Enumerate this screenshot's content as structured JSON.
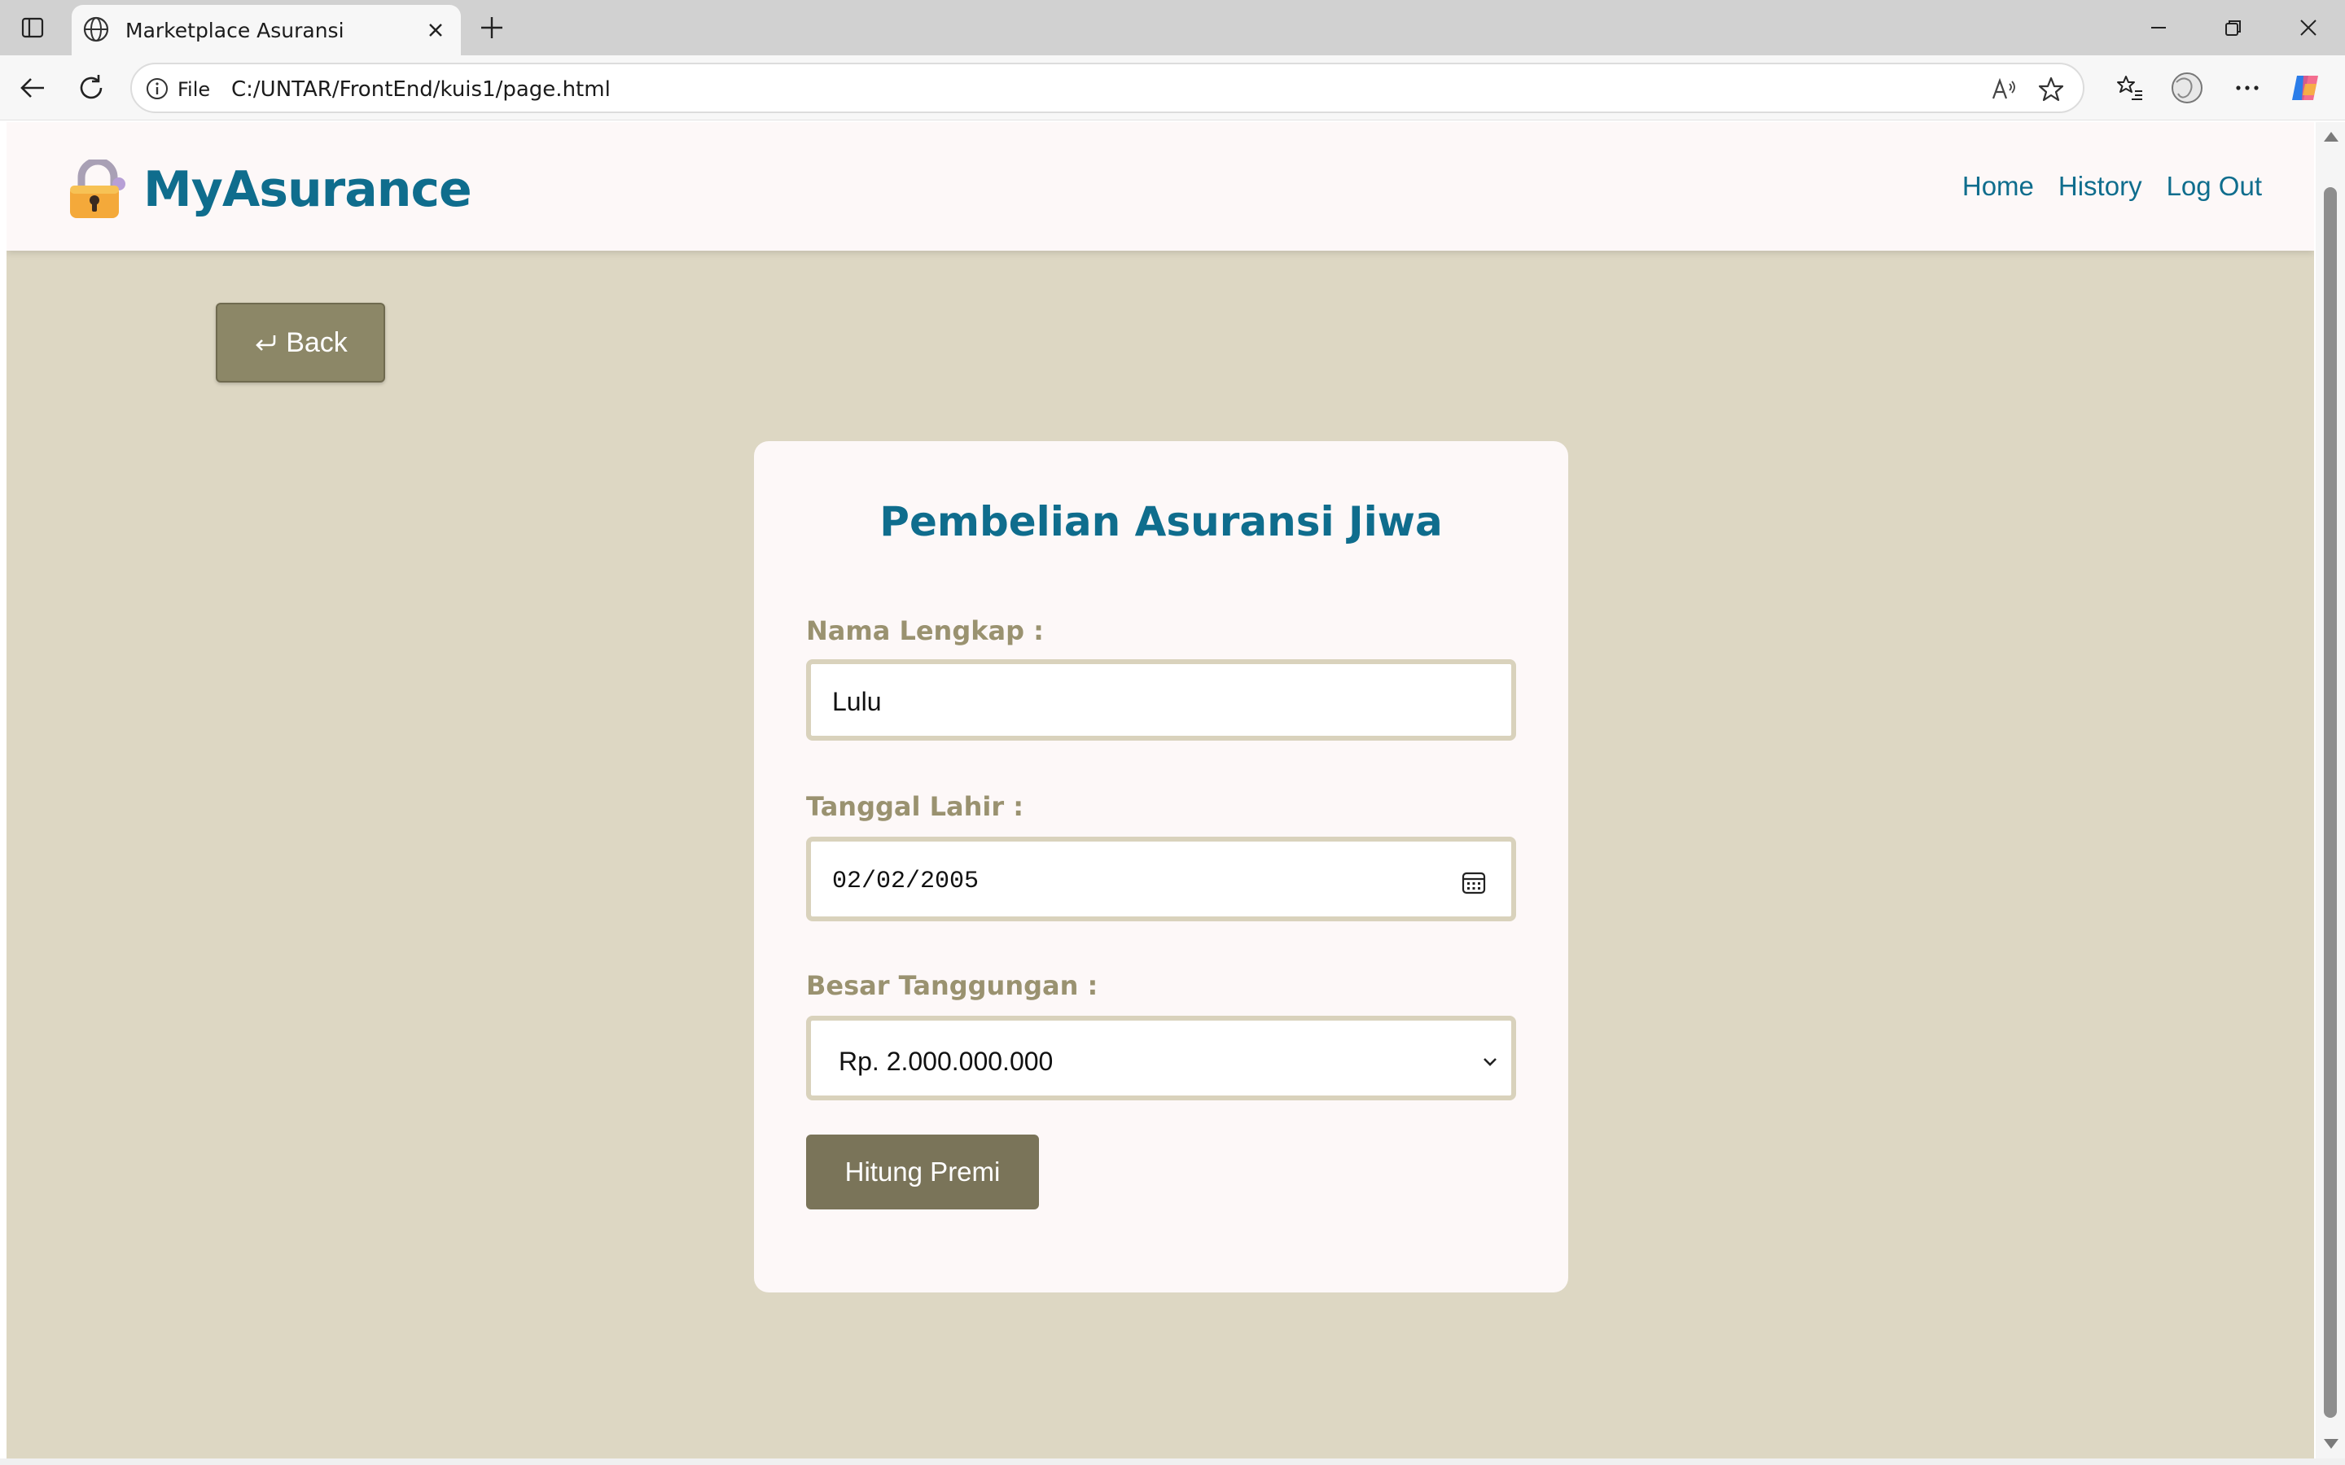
{
  "browser": {
    "tab_title": "Marketplace Asuransi",
    "address_scheme_label": "File",
    "url": "C:/UNTAR/FrontEnd/kuis1/page.html"
  },
  "site": {
    "brand": "MyAsurance",
    "nav": [
      "Home",
      "History",
      "Log Out"
    ],
    "back_label": "Back"
  },
  "form": {
    "title": "Pembelian Asuransi Jiwa",
    "name_label": "Nama Lengkap :",
    "name_value": "Lulu",
    "dob_label": "Tanggal Lahir :",
    "dob_value": "02/02/2005",
    "coverage_label": "Besar Tanggungan :",
    "coverage_value": "Rp. 2.000.000.000",
    "submit_label": "Hitung Premi"
  },
  "colors": {
    "brand": "#0f6d8d",
    "page_background": "#ddd7c3",
    "button": "#7a7459",
    "label": "#9a9270"
  },
  "icons": [
    "sidebar-toggle-icon",
    "globe-icon",
    "close-icon",
    "plus-icon",
    "minimize-icon",
    "restore-icon",
    "back-arrow-icon",
    "refresh-icon",
    "info-icon",
    "read-aloud-icon",
    "star-icon",
    "favorites-icon",
    "profile-icon",
    "more-icon",
    "copilot-icon",
    "lock-icon",
    "return-arrow-icon",
    "calendar-icon",
    "chevron-down-icon"
  ]
}
